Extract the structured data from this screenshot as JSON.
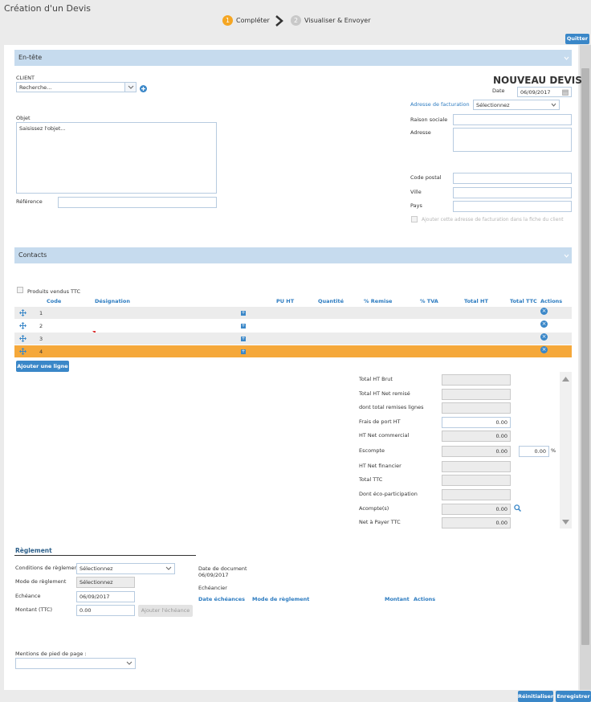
{
  "header": {
    "title": "Création d'un Devis",
    "steps": [
      {
        "num": "1",
        "label": "Compléter",
        "active": true
      },
      {
        "num": "2",
        "label": "Visualiser & Envoyer",
        "active": false
      }
    ],
    "quit_label": "Quitter"
  },
  "entete": {
    "section_title": "En-tête",
    "client_label": "CLIENT",
    "client_placeholder": "Recherche...",
    "doc_title": "NOUVEAU DEVIS",
    "date_label": "Date",
    "date_value": "06/09/2017",
    "objet_label": "Objet",
    "objet_placeholder": "Saisissez l'objet...",
    "reference_label": "Référence",
    "billing": {
      "label": "Adresse de facturation",
      "select_value": "Sélectionnez",
      "raison_label": "Raison sociale",
      "adresse_label": "Adresse",
      "cp_label": "Code postal",
      "ville_label": "Ville",
      "pays_label": "Pays",
      "checkbox_label": "Ajouter cette adresse de facturation dans la fiche du client"
    }
  },
  "contacts": {
    "section_title": "Contacts"
  },
  "lines": {
    "ttc_checkbox_label": "Produits vendus TTC",
    "columns": {
      "code": "Code",
      "designation": "Désignation",
      "pu_ht": "PU HT",
      "quantite": "Quantité",
      "remise": "% Remise",
      "tva": "% TVA",
      "total_ht": "Total HT",
      "total_ttc": "Total TTC",
      "actions": "Actions"
    },
    "rows": [
      {
        "code": "1"
      },
      {
        "code": "2"
      },
      {
        "code": "3"
      },
      {
        "code": "4"
      }
    ],
    "add_line_label": "Ajouter une ligne -"
  },
  "totals": {
    "total_ht_brut": "Total HT Brut",
    "total_ht_net_remise": "Total HT Net remisé",
    "dont_remises_lignes": "dont total remises lignes",
    "frais_port_label": "Frais de port HT",
    "frais_port_value": "0.00",
    "ht_net_commercial_label": "HT Net commercial",
    "ht_net_commercial_value": "0.00",
    "escompte_label": "Escompte",
    "escompte_value": "0.00",
    "escompte_pct_value": "0.00",
    "pct_sign": "%",
    "ht_net_financier": "HT Net financier",
    "total_ttc": "Total TTC",
    "eco_participation": "Dont éco-participation",
    "acompte_label": "Acompte(s)",
    "acompte_value": "0.00",
    "net_a_payer_label": "Net à Payer TTC",
    "net_a_payer_value": "0.00"
  },
  "reglement": {
    "title": "Règlement",
    "conditions_label": "Conditions de règlement",
    "conditions_value": "Sélectionnez",
    "mode_label": "Mode de règlement",
    "mode_value": "Sélectionnez",
    "echeance_label": "Echéance",
    "echeance_value": "06/09/2017",
    "montant_label": "Montant (TTC)",
    "montant_value": "0.00",
    "add_echeance_label": "Ajouter l'échéance",
    "date_document_label": "Date de document",
    "date_document_value": "06/09/2017",
    "echeancier_label": "Echéancier",
    "cols": {
      "date": "Date échéances",
      "mode": "Mode de règlement",
      "montant": "Montant",
      "actions": "Actions"
    }
  },
  "footer": {
    "mentions_label": "Mentions de pied de page :",
    "reset_label": "Réinitialiser",
    "save_label": "Enregistrer"
  },
  "colors": {
    "accent": "#3a87c8",
    "active_step": "#f5a623",
    "section_bg": "#c6dbee",
    "highlight_row": "#f5a83a"
  }
}
